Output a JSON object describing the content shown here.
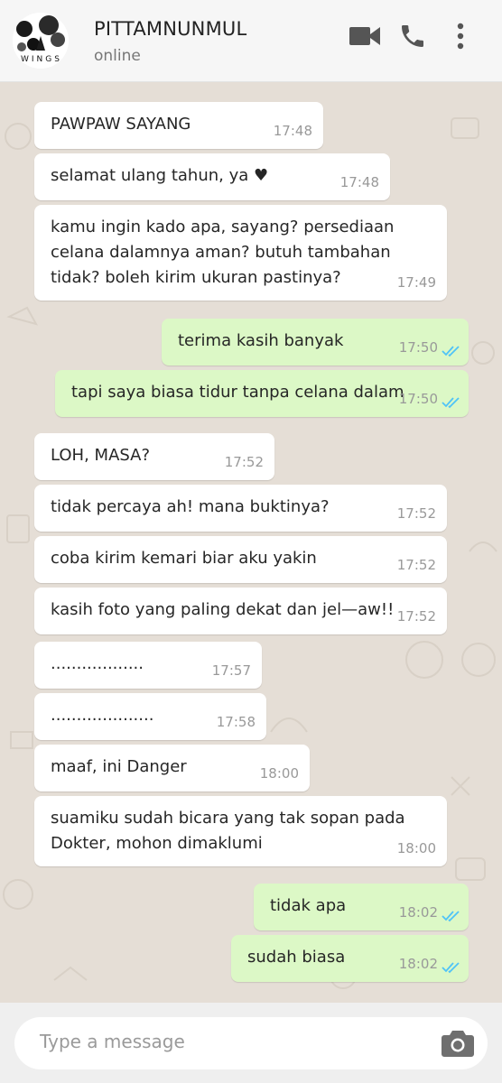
{
  "header": {
    "contact_name": "PITTAMNUNMUL",
    "status": "online",
    "avatar_text": "WINGS",
    "icons": [
      "video-call-icon",
      "phone-icon",
      "more-options-icon"
    ]
  },
  "messages": [
    {
      "dir": "in",
      "text": "PAWPAW SAYANG",
      "time": "17:48"
    },
    {
      "dir": "in",
      "text": "selamat ulang tahun, ya ♥",
      "time": "17:48"
    },
    {
      "dir": "in",
      "text": "kamu ingin kado apa, sayang? persediaan\ncelana dalamnya aman? butuh tambahan\ntidak? boleh kirim ukuran pastinya?",
      "time": "17:49"
    },
    {
      "dir": "out",
      "text": "terima kasih banyak",
      "time": "17:50",
      "status": "read"
    },
    {
      "dir": "out",
      "text": "tapi saya biasa tidur tanpa celana dalam",
      "time": "17:50",
      "status": "read"
    },
    {
      "dir": "in",
      "text": "LOH, MASA?",
      "time": "17:52"
    },
    {
      "dir": "in",
      "text": "tidak percaya ah! mana buktinya?",
      "time": "17:52"
    },
    {
      "dir": "in",
      "text": "coba kirim kemari biar aku yakin",
      "time": "17:52"
    },
    {
      "dir": "in",
      "text": "kasih foto yang paling dekat dan jel—aw!!",
      "time": "17:52"
    },
    {
      "dir": "in",
      "text": "..................",
      "time": "17:57"
    },
    {
      "dir": "in",
      "text": "....................",
      "time": "17:58"
    },
    {
      "dir": "in",
      "text": "maaf, ini Danger",
      "time": "18:00"
    },
    {
      "dir": "in",
      "text": "suamiku sudah bicara yang tak sopan pada\nDokter, mohon dimaklumi",
      "time": "18:00"
    },
    {
      "dir": "out",
      "text": "tidak apa",
      "time": "18:02",
      "status": "read"
    },
    {
      "dir": "out",
      "text": "sudah biasa",
      "time": "18:02",
      "status": "read"
    }
  ],
  "composer": {
    "placeholder": "Type a message",
    "icon": "camera-icon"
  },
  "colors": {
    "incoming_bubble": "#ffffff",
    "outgoing_bubble": "#dcf8c6",
    "read_ticks": "#4fc3f7",
    "chat_background": "#e5ded6"
  }
}
